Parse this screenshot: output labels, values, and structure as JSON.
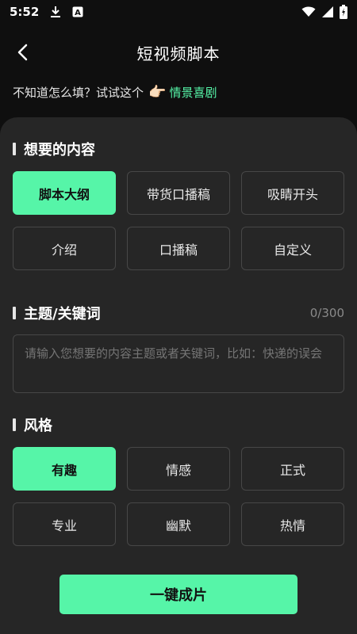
{
  "status_bar": {
    "time": "5:52",
    "icons": [
      "download-icon",
      "font-a-icon",
      "wifi-icon",
      "signal-icon",
      "battery-charging-icon"
    ]
  },
  "header": {
    "title": "短视频脚本",
    "back_icon": "chevron-left-icon"
  },
  "hint": {
    "text": "不知道怎么填？试试这个",
    "emoji": "👉🏻",
    "link": "情景喜剧"
  },
  "content_section": {
    "title": "想要的内容",
    "options": [
      "脚本大纲",
      "带货口播稿",
      "吸睛开头",
      "介绍",
      "口播稿",
      "自定义"
    ],
    "selected": "脚本大纲"
  },
  "topic_section": {
    "title": "主题/关键词",
    "counter": "0/300",
    "value": "",
    "placeholder": "请输入您想要的内容主题或者关键词，比如：快递的误会"
  },
  "style_section": {
    "title": "风格",
    "options": [
      "有趣",
      "情感",
      "正式",
      "专业",
      "幽默",
      "热情"
    ],
    "selected": "有趣"
  },
  "submit": {
    "label": "一键成片"
  },
  "colors": {
    "accent": "#56f5a8",
    "background": "#0f0f0f",
    "panel": "#262626",
    "chip_border": "#474747"
  }
}
